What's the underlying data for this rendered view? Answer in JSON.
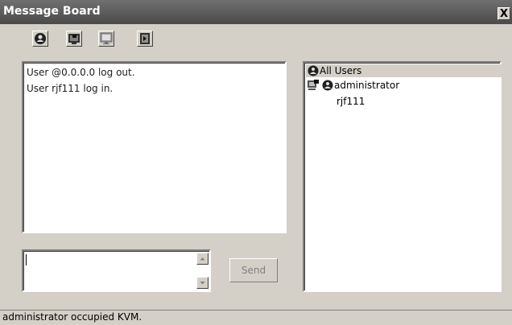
{
  "window": {
    "title": "Message Board",
    "close_label": "X"
  },
  "toolbar": {
    "buttons": [
      "person-icon",
      "monitor-lock-icon",
      "monitor-icon",
      "exit-icon"
    ]
  },
  "log": {
    "lines": [
      "User @0.0.0.0 log out.",
      "User rjf111 log in."
    ]
  },
  "users": {
    "all_users_label": "All Users",
    "list": [
      {
        "name": "administrator",
        "icons": [
          "computer-lock-icon",
          "person-icon"
        ]
      },
      {
        "name": "rjf111",
        "icons": []
      }
    ]
  },
  "compose": {
    "value": "",
    "send_label": "Send"
  },
  "status": {
    "text": "administrator occupied KVM."
  }
}
